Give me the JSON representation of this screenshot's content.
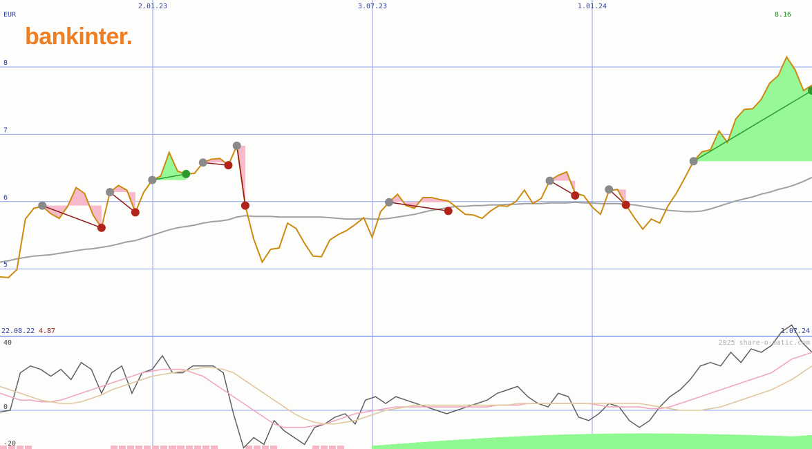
{
  "brand": "bankinter.",
  "currency": "EUR",
  "copyright": "2025 share-o-matic.com",
  "colors": {
    "price": "#cc8a11",
    "ma_long": "#a0a0a0",
    "grid": "#8aa0f0",
    "brand": "#ef7d22",
    "gain_fill": "#90f890",
    "loss_fill": "#f7b6c8",
    "gain_marker": "#2d9a2d",
    "loss_marker": "#b2241a",
    "neutral_marker": "#8a8a8a",
    "gain_line": "#2d9a2d",
    "loss_line": "#8b1a1a",
    "axis_text": "#3040a0",
    "last_value": "#1a8a1a",
    "low_value": "#8b1a1a",
    "osc_main": "#606060",
    "osc_signal1": "#f0a8c0",
    "osc_signal2": "#e0c8a0"
  },
  "chart_data": [
    {
      "type": "line",
      "panel": "price",
      "x_tick_labels": [
        "2.01.23",
        "3.07.23",
        "1.01.24"
      ],
      "y_ticks": [
        5,
        6,
        7,
        8
      ],
      "ylim": [
        4.05,
        9.05
      ],
      "date_start": "22.08.22",
      "date_end": "1.07.24",
      "last_value": "8.16",
      "low_value": "4.87",
      "series": [
        {
          "role": "price",
          "values": [
            4.88,
            4.87,
            4.99,
            5.74,
            5.9,
            5.93,
            5.82,
            5.75,
            5.93,
            6.21,
            6.12,
            5.8,
            5.61,
            6.14,
            6.24,
            6.17,
            5.84,
            6.14,
            6.32,
            6.38,
            6.73,
            6.45,
            6.41,
            6.42,
            6.58,
            6.63,
            6.64,
            6.54,
            6.83,
            5.94,
            5.44,
            5.1,
            5.29,
            5.31,
            5.68,
            5.6,
            5.38,
            5.19,
            5.18,
            5.43,
            5.51,
            5.57,
            5.66,
            5.76,
            5.47,
            5.85,
            5.99,
            6.11,
            5.94,
            5.9,
            6.06,
            6.06,
            6.03,
            6.01,
            5.91,
            5.81,
            5.8,
            5.75,
            5.86,
            5.94,
            5.93,
            6.0,
            6.17,
            5.97,
            6.05,
            6.31,
            6.39,
            6.44,
            6.12,
            6.09,
            5.92,
            5.81,
            6.16,
            6.18,
            5.95,
            5.76,
            5.59,
            5.74,
            5.68,
            5.94,
            6.13,
            6.36,
            6.6,
            6.74,
            6.77,
            7.05,
            6.88,
            7.23,
            7.37,
            7.38,
            7.52,
            7.76,
            7.87,
            8.15,
            7.96,
            7.65,
            7.73
          ]
        },
        {
          "role": "long moving average",
          "values": [
            5.1,
            5.12,
            5.15,
            5.17,
            5.19,
            5.2,
            5.21,
            5.23,
            5.25,
            5.27,
            5.29,
            5.3,
            5.32,
            5.34,
            5.37,
            5.4,
            5.42,
            5.46,
            5.5,
            5.54,
            5.58,
            5.61,
            5.63,
            5.65,
            5.68,
            5.7,
            5.71,
            5.73,
            5.77,
            5.79,
            5.78,
            5.78,
            5.78,
            5.77,
            5.77,
            5.77,
            5.77,
            5.77,
            5.77,
            5.76,
            5.75,
            5.74,
            5.74,
            5.75,
            5.74,
            5.74,
            5.75,
            5.77,
            5.79,
            5.81,
            5.84,
            5.87,
            5.89,
            5.91,
            5.93,
            5.93,
            5.94,
            5.94,
            5.95,
            5.95,
            5.96,
            5.96,
            5.97,
            5.97,
            5.97,
            5.98,
            5.98,
            5.98,
            5.99,
            5.98,
            5.98,
            5.97,
            5.97,
            5.97,
            5.96,
            5.95,
            5.93,
            5.91,
            5.89,
            5.87,
            5.86,
            5.85,
            5.85,
            5.86,
            5.89,
            5.93,
            5.97,
            6.01,
            6.04,
            6.07,
            6.11,
            6.14,
            6.18,
            6.21,
            6.25,
            6.3,
            6.36
          ]
        }
      ],
      "signals": [
        {
          "buy": [
            5,
            5.94
          ],
          "sell": [
            12,
            5.61
          ],
          "result": "loss"
        },
        {
          "buy": [
            13,
            6.14
          ],
          "sell": [
            16,
            5.84
          ],
          "result": "loss"
        },
        {
          "buy": [
            18,
            6.32
          ],
          "sell": [
            22,
            6.41
          ],
          "result": "gain"
        },
        {
          "buy": [
            24,
            6.58
          ],
          "sell": [
            27,
            6.54
          ],
          "result": "loss"
        },
        {
          "buy": [
            28,
            6.83
          ],
          "sell": [
            29,
            5.94
          ],
          "result": "loss"
        },
        {
          "buy": [
            46,
            5.99
          ],
          "sell": [
            53,
            5.86
          ],
          "result": "loss"
        },
        {
          "buy": [
            65,
            6.31
          ],
          "sell": [
            68,
            6.09
          ],
          "result": "loss"
        },
        {
          "buy": [
            72,
            6.18
          ],
          "sell": [
            74,
            5.95
          ],
          "result": "loss"
        },
        {
          "buy": [
            82,
            6.6
          ],
          "sell": [
            96,
            7.65
          ],
          "result": "gain"
        }
      ]
    },
    {
      "type": "line",
      "panel": "oscillator",
      "y_ticks": [
        -20,
        0,
        40
      ],
      "ylim": [
        -22,
        46
      ],
      "series": [
        {
          "role": "main",
          "values": [
            -1,
            0,
            22,
            26,
            24,
            20,
            24,
            18,
            28,
            24,
            10,
            22,
            26,
            10,
            22,
            24,
            32,
            22,
            22,
            26,
            26,
            26,
            22,
            -2,
            -22,
            -16,
            -20,
            -6,
            -12,
            -16,
            -20,
            -10,
            -8,
            -4,
            -2,
            -8,
            6,
            8,
            4,
            8,
            6,
            4,
            2,
            0,
            -2,
            0,
            2,
            4,
            6,
            10,
            12,
            14,
            8,
            4,
            2,
            10,
            8,
            -4,
            -6,
            -2,
            4,
            2,
            -6,
            -10,
            -6,
            2,
            8,
            12,
            18,
            26,
            28,
            26,
            34,
            28,
            36,
            34,
            38,
            46,
            50,
            40,
            34
          ],
          "x_start_index": 0
        },
        {
          "role": "signal pink",
          "values": [
            10,
            8,
            6,
            6,
            5,
            5,
            6,
            8,
            10,
            12,
            14,
            16,
            18,
            20,
            22,
            23,
            24,
            24,
            24,
            22,
            20,
            16,
            12,
            8,
            4,
            0,
            -4,
            -8,
            -10,
            -10,
            -10,
            -9,
            -8,
            -6,
            -4,
            -2,
            -1,
            0,
            1,
            2,
            2,
            2,
            2,
            2,
            2,
            2,
            2,
            2,
            2,
            3,
            3,
            3,
            4,
            4,
            4,
            4,
            4,
            4,
            4,
            3,
            2,
            2,
            2,
            2,
            1,
            1,
            2,
            4,
            6,
            8,
            10,
            12,
            14,
            16,
            18,
            20,
            22,
            26,
            30,
            32,
            34
          ],
          "x_start_index": 0
        },
        {
          "role": "signal beige",
          "values": [
            14,
            12,
            10,
            8,
            6,
            5,
            4,
            4,
            5,
            7,
            9,
            12,
            14,
            16,
            18,
            20,
            21,
            22,
            23,
            24,
            25,
            25,
            24,
            22,
            18,
            14,
            10,
            6,
            2,
            -2,
            -5,
            -7,
            -8,
            -8,
            -7,
            -6,
            -4,
            -2,
            0,
            1,
            2,
            3,
            3,
            3,
            3,
            3,
            3,
            3,
            3,
            3,
            3,
            4,
            4,
            4,
            4,
            4,
            4,
            4,
            4,
            4,
            4,
            4,
            4,
            4,
            3,
            2,
            1,
            0,
            0,
            0,
            1,
            2,
            4,
            6,
            8,
            10,
            12,
            15,
            18,
            22,
            26
          ],
          "x_start_index": 0
        }
      ],
      "volume_bars": [
        {
          "result": "loss",
          "x_range": [
            0,
            37
          ]
        },
        {
          "result": "loss",
          "x_range": [
            160,
            265
          ]
        },
        {
          "result": "loss",
          "x_range": [
            245,
            310
          ]
        },
        {
          "result": "loss",
          "x_range": [
            355,
            392
          ]
        },
        {
          "result": "loss",
          "x_range": [
            452,
            490
          ]
        },
        {
          "result": "gain",
          "x_range": [
            538,
            1175
          ]
        }
      ]
    }
  ]
}
